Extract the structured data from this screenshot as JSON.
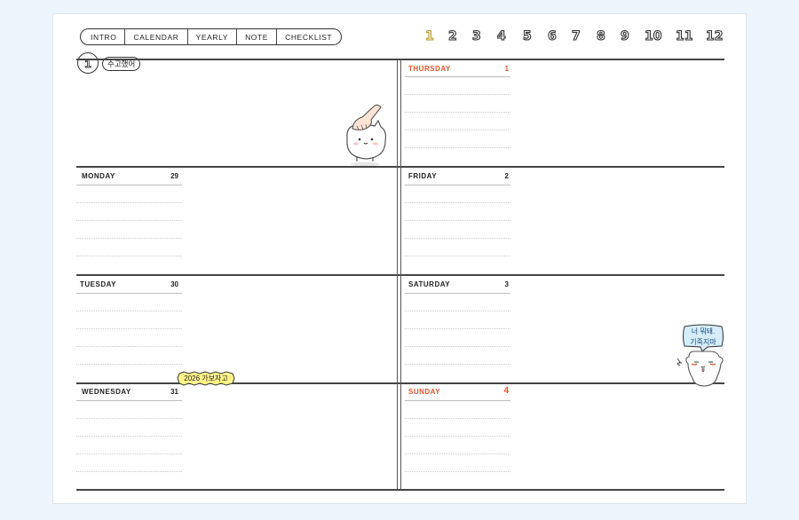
{
  "nav": {
    "tabs": [
      "INTRO",
      "CALENDAR",
      "YEARLY",
      "NOTE",
      "CHECKLIST"
    ],
    "months": [
      "1",
      "2",
      "3",
      "4",
      "5",
      "6",
      "7",
      "8",
      "9",
      "10",
      "11",
      "12"
    ],
    "active_month": "1"
  },
  "week": {
    "month_badge": "1",
    "month_tag": "수고했어",
    "days": [
      {
        "label": "MONDAY",
        "num": "29"
      },
      {
        "label": "TUESDAY",
        "num": "30"
      },
      {
        "label": "WEDNESDAY",
        "num": "31"
      },
      {
        "label": "THURSDAY",
        "num": "1"
      },
      {
        "label": "FRIDAY",
        "num": "2"
      },
      {
        "label": "SATURDAY",
        "num": "3"
      },
      {
        "label": "SUNDAY",
        "num": "4"
      }
    ]
  },
  "stickers": {
    "year_label": "2026 가보자고",
    "speech_line1": "너 뭐돼.",
    "speech_line2": "기죽지마"
  },
  "colors": {
    "accent_red": "#e4522b",
    "active_month": "#b79a3c",
    "sticker_yellow": "#fff38a",
    "speech_blue": "#d4ecfb"
  }
}
